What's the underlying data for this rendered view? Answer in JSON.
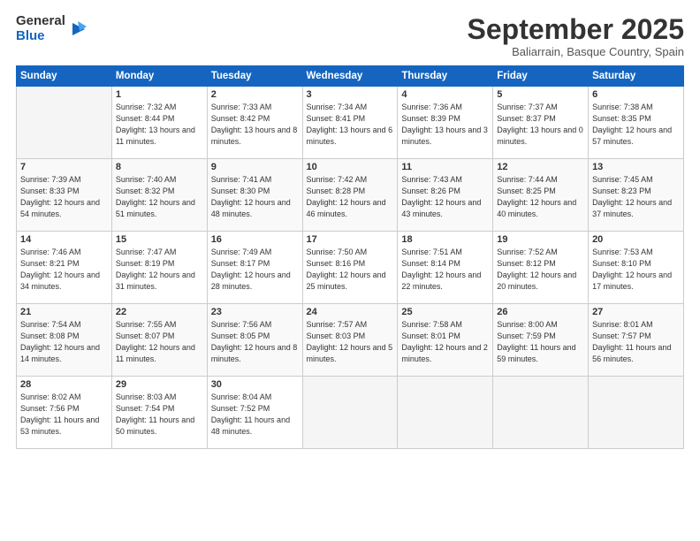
{
  "logo": {
    "line1": "General",
    "line2": "Blue"
  },
  "title": "September 2025",
  "subtitle": "Baliarrain, Basque Country, Spain",
  "days_header": [
    "Sunday",
    "Monday",
    "Tuesday",
    "Wednesday",
    "Thursday",
    "Friday",
    "Saturday"
  ],
  "weeks": [
    [
      {
        "num": "",
        "sunrise": "",
        "sunset": "",
        "daylight": ""
      },
      {
        "num": "1",
        "sunrise": "Sunrise: 7:32 AM",
        "sunset": "Sunset: 8:44 PM",
        "daylight": "Daylight: 13 hours and 11 minutes."
      },
      {
        "num": "2",
        "sunrise": "Sunrise: 7:33 AM",
        "sunset": "Sunset: 8:42 PM",
        "daylight": "Daylight: 13 hours and 8 minutes."
      },
      {
        "num": "3",
        "sunrise": "Sunrise: 7:34 AM",
        "sunset": "Sunset: 8:41 PM",
        "daylight": "Daylight: 13 hours and 6 minutes."
      },
      {
        "num": "4",
        "sunrise": "Sunrise: 7:36 AM",
        "sunset": "Sunset: 8:39 PM",
        "daylight": "Daylight: 13 hours and 3 minutes."
      },
      {
        "num": "5",
        "sunrise": "Sunrise: 7:37 AM",
        "sunset": "Sunset: 8:37 PM",
        "daylight": "Daylight: 13 hours and 0 minutes."
      },
      {
        "num": "6",
        "sunrise": "Sunrise: 7:38 AM",
        "sunset": "Sunset: 8:35 PM",
        "daylight": "Daylight: 12 hours and 57 minutes."
      }
    ],
    [
      {
        "num": "7",
        "sunrise": "Sunrise: 7:39 AM",
        "sunset": "Sunset: 8:33 PM",
        "daylight": "Daylight: 12 hours and 54 minutes."
      },
      {
        "num": "8",
        "sunrise": "Sunrise: 7:40 AM",
        "sunset": "Sunset: 8:32 PM",
        "daylight": "Daylight: 12 hours and 51 minutes."
      },
      {
        "num": "9",
        "sunrise": "Sunrise: 7:41 AM",
        "sunset": "Sunset: 8:30 PM",
        "daylight": "Daylight: 12 hours and 48 minutes."
      },
      {
        "num": "10",
        "sunrise": "Sunrise: 7:42 AM",
        "sunset": "Sunset: 8:28 PM",
        "daylight": "Daylight: 12 hours and 46 minutes."
      },
      {
        "num": "11",
        "sunrise": "Sunrise: 7:43 AM",
        "sunset": "Sunset: 8:26 PM",
        "daylight": "Daylight: 12 hours and 43 minutes."
      },
      {
        "num": "12",
        "sunrise": "Sunrise: 7:44 AM",
        "sunset": "Sunset: 8:25 PM",
        "daylight": "Daylight: 12 hours and 40 minutes."
      },
      {
        "num": "13",
        "sunrise": "Sunrise: 7:45 AM",
        "sunset": "Sunset: 8:23 PM",
        "daylight": "Daylight: 12 hours and 37 minutes."
      }
    ],
    [
      {
        "num": "14",
        "sunrise": "Sunrise: 7:46 AM",
        "sunset": "Sunset: 8:21 PM",
        "daylight": "Daylight: 12 hours and 34 minutes."
      },
      {
        "num": "15",
        "sunrise": "Sunrise: 7:47 AM",
        "sunset": "Sunset: 8:19 PM",
        "daylight": "Daylight: 12 hours and 31 minutes."
      },
      {
        "num": "16",
        "sunrise": "Sunrise: 7:49 AM",
        "sunset": "Sunset: 8:17 PM",
        "daylight": "Daylight: 12 hours and 28 minutes."
      },
      {
        "num": "17",
        "sunrise": "Sunrise: 7:50 AM",
        "sunset": "Sunset: 8:16 PM",
        "daylight": "Daylight: 12 hours and 25 minutes."
      },
      {
        "num": "18",
        "sunrise": "Sunrise: 7:51 AM",
        "sunset": "Sunset: 8:14 PM",
        "daylight": "Daylight: 12 hours and 22 minutes."
      },
      {
        "num": "19",
        "sunrise": "Sunrise: 7:52 AM",
        "sunset": "Sunset: 8:12 PM",
        "daylight": "Daylight: 12 hours and 20 minutes."
      },
      {
        "num": "20",
        "sunrise": "Sunrise: 7:53 AM",
        "sunset": "Sunset: 8:10 PM",
        "daylight": "Daylight: 12 hours and 17 minutes."
      }
    ],
    [
      {
        "num": "21",
        "sunrise": "Sunrise: 7:54 AM",
        "sunset": "Sunset: 8:08 PM",
        "daylight": "Daylight: 12 hours and 14 minutes."
      },
      {
        "num": "22",
        "sunrise": "Sunrise: 7:55 AM",
        "sunset": "Sunset: 8:07 PM",
        "daylight": "Daylight: 12 hours and 11 minutes."
      },
      {
        "num": "23",
        "sunrise": "Sunrise: 7:56 AM",
        "sunset": "Sunset: 8:05 PM",
        "daylight": "Daylight: 12 hours and 8 minutes."
      },
      {
        "num": "24",
        "sunrise": "Sunrise: 7:57 AM",
        "sunset": "Sunset: 8:03 PM",
        "daylight": "Daylight: 12 hours and 5 minutes."
      },
      {
        "num": "25",
        "sunrise": "Sunrise: 7:58 AM",
        "sunset": "Sunset: 8:01 PM",
        "daylight": "Daylight: 12 hours and 2 minutes."
      },
      {
        "num": "26",
        "sunrise": "Sunrise: 8:00 AM",
        "sunset": "Sunset: 7:59 PM",
        "daylight": "Daylight: 11 hours and 59 minutes."
      },
      {
        "num": "27",
        "sunrise": "Sunrise: 8:01 AM",
        "sunset": "Sunset: 7:57 PM",
        "daylight": "Daylight: 11 hours and 56 minutes."
      }
    ],
    [
      {
        "num": "28",
        "sunrise": "Sunrise: 8:02 AM",
        "sunset": "Sunset: 7:56 PM",
        "daylight": "Daylight: 11 hours and 53 minutes."
      },
      {
        "num": "29",
        "sunrise": "Sunrise: 8:03 AM",
        "sunset": "Sunset: 7:54 PM",
        "daylight": "Daylight: 11 hours and 50 minutes."
      },
      {
        "num": "30",
        "sunrise": "Sunrise: 8:04 AM",
        "sunset": "Sunset: 7:52 PM",
        "daylight": "Daylight: 11 hours and 48 minutes."
      },
      {
        "num": "",
        "sunrise": "",
        "sunset": "",
        "daylight": ""
      },
      {
        "num": "",
        "sunrise": "",
        "sunset": "",
        "daylight": ""
      },
      {
        "num": "",
        "sunrise": "",
        "sunset": "",
        "daylight": ""
      },
      {
        "num": "",
        "sunrise": "",
        "sunset": "",
        "daylight": ""
      }
    ]
  ]
}
